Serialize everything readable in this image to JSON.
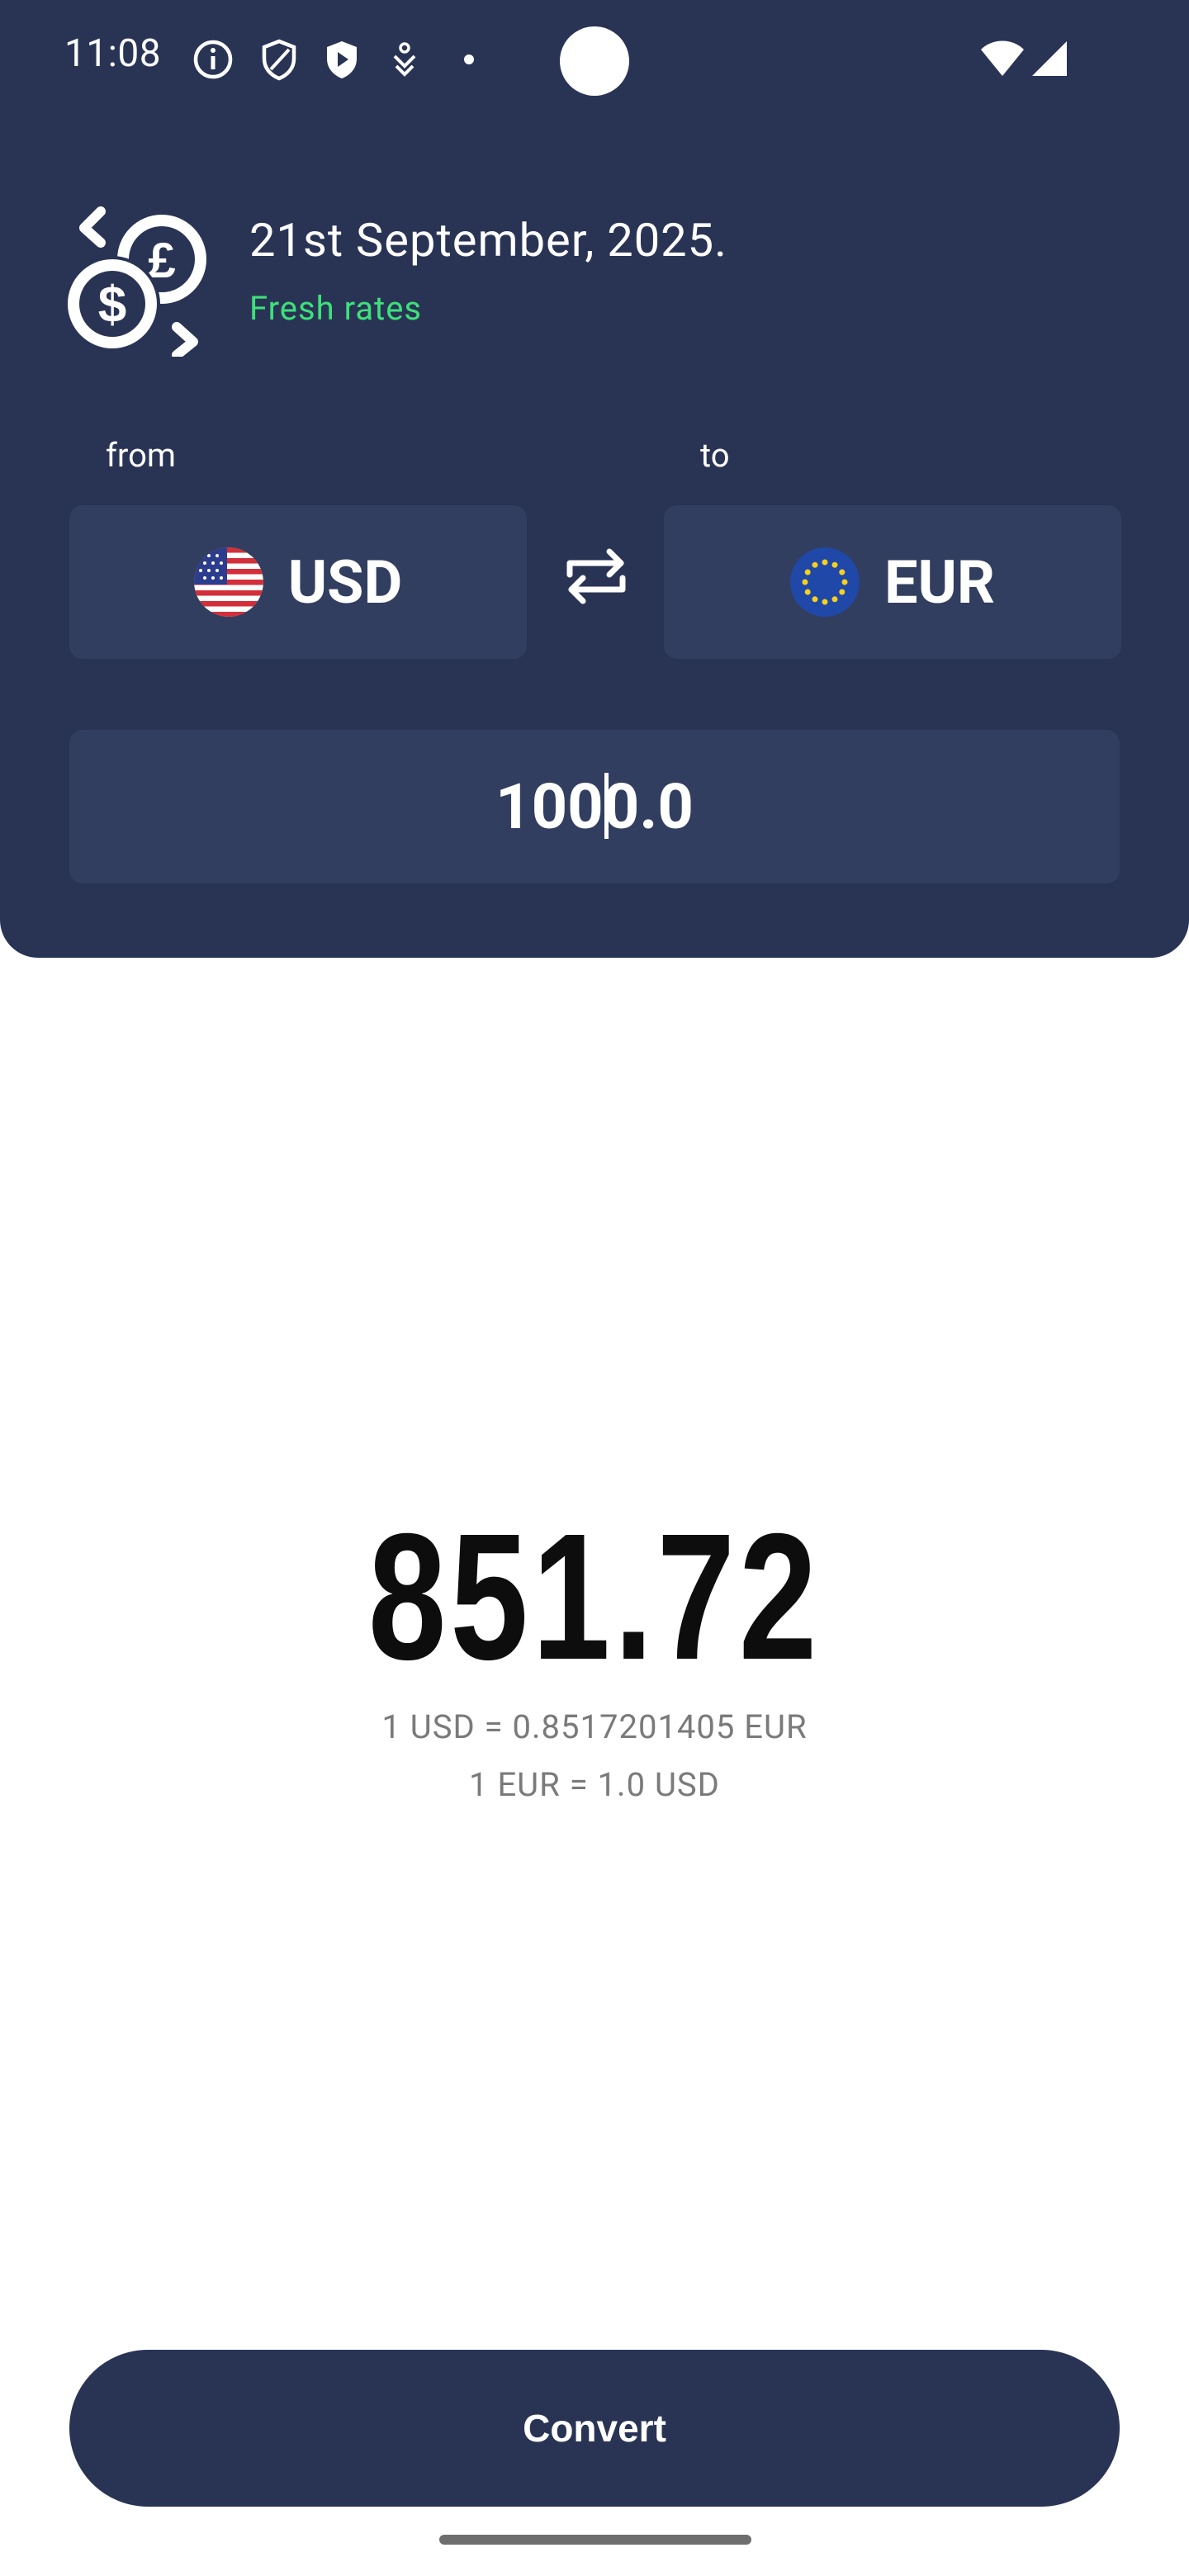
{
  "status_bar": {
    "time": "11:08",
    "icons": [
      "info-circle-icon",
      "shield-outline-icon",
      "shield-play-icon",
      "accessibility-icon",
      "dot-icon"
    ],
    "right_icons": [
      "wifi-icon",
      "signal-icon"
    ]
  },
  "header": {
    "date": "21st September, 2025.",
    "freshness": "Fresh rates",
    "freshness_color": "#3ee07a",
    "from_label": "from",
    "to_label": "to",
    "from_currency": "USD",
    "to_currency": "EUR",
    "amount": "1000.0"
  },
  "result": {
    "value": "851.72",
    "rate_forward": "1 USD = 0.8517201405 EUR",
    "rate_reverse": "1 EUR = 1.0 USD"
  },
  "actions": {
    "convert_label": "Convert"
  },
  "colors": {
    "primary": "#293455",
    "field_bg": "#323e5f",
    "accent_green": "#3ee07a"
  }
}
